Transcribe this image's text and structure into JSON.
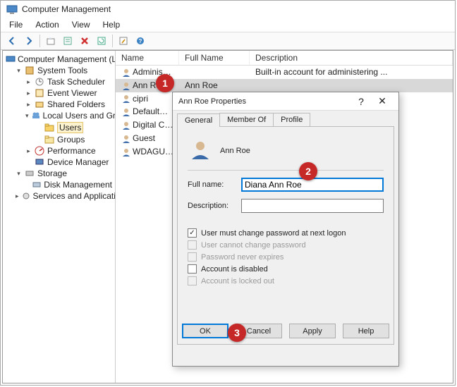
{
  "window": {
    "title": "Computer Management"
  },
  "menubar": [
    "File",
    "Action",
    "View",
    "Help"
  ],
  "toolbar_icons": [
    "back-icon",
    "forward-icon",
    "up-icon",
    "properties-icon",
    "delete-icon",
    "refresh-icon",
    "export-icon",
    "help-icon"
  ],
  "tree": {
    "root": "Computer Management (Local)",
    "system_tools": "System Tools",
    "task_scheduler": "Task Scheduler",
    "event_viewer": "Event Viewer",
    "shared_folders": "Shared Folders",
    "local_users": "Local Users and Groups",
    "users": "Users",
    "groups": "Groups",
    "performance": "Performance",
    "device_manager": "Device Manager",
    "storage": "Storage",
    "disk_management": "Disk Management",
    "services": "Services and Applications"
  },
  "list": {
    "columns": {
      "name": "Name",
      "fullname": "Full Name",
      "description": "Description"
    },
    "rows": [
      {
        "name": "Administrator",
        "fullname": "",
        "description": "Built-in account for administering ..."
      },
      {
        "name": "Ann Roe",
        "fullname": "Ann Roe",
        "description": ""
      },
      {
        "name": "cipri",
        "fullname": "",
        "description": ""
      },
      {
        "name": "DefaultAcco...",
        "fullname": "",
        "description": ""
      },
      {
        "name": "Digital Citizen",
        "fullname": "",
        "description": ""
      },
      {
        "name": "Guest",
        "fullname": "",
        "description": ""
      },
      {
        "name": "WDAGUtility...",
        "fullname": "",
        "description": ""
      }
    ]
  },
  "dialog": {
    "title": "Ann Roe Properties",
    "help": "?",
    "tabs": {
      "general": "General",
      "memberof": "Member Of",
      "profile": "Profile"
    },
    "username": "Ann Roe",
    "labels": {
      "fullname": "Full name:",
      "description": "Description:"
    },
    "fields": {
      "fullname": "Diana Ann Roe",
      "description": ""
    },
    "checks": {
      "must_change": "User must change password at next logon",
      "cannot_change": "User cannot change password",
      "never_expires": "Password never expires",
      "disabled": "Account is disabled",
      "locked": "Account is locked out"
    },
    "buttons": {
      "ok": "OK",
      "cancel": "Cancel",
      "apply": "Apply",
      "help": "Help"
    }
  },
  "callouts": {
    "one": "1",
    "two": "2",
    "three": "3"
  }
}
